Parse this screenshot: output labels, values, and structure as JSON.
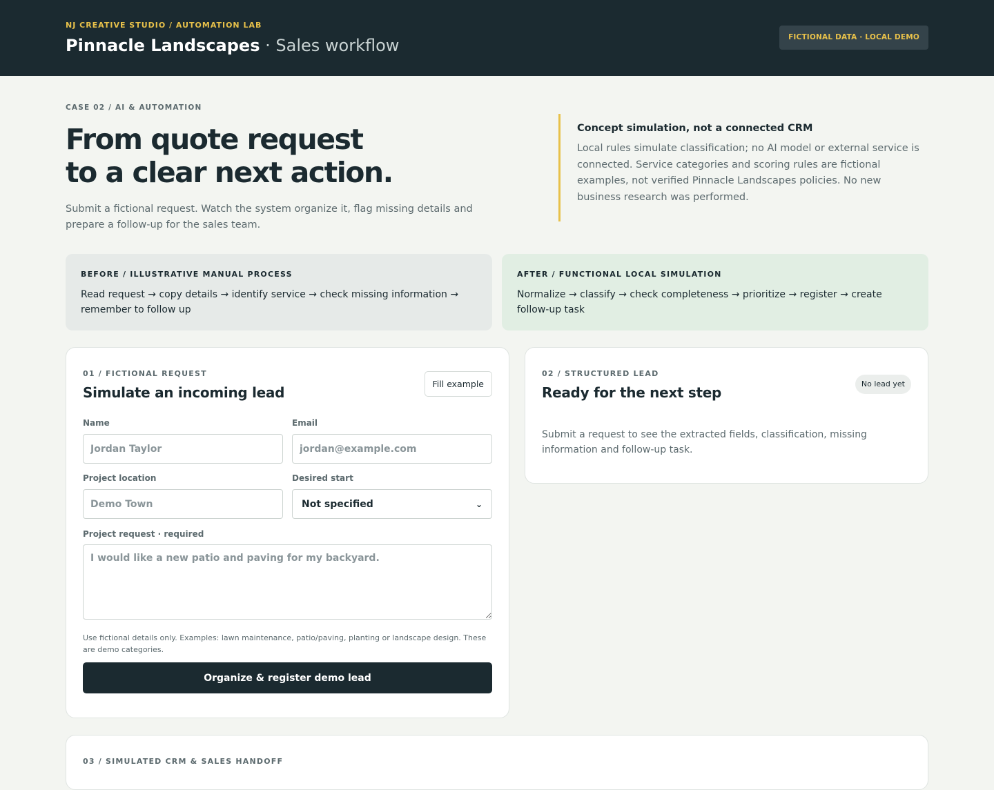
{
  "header": {
    "eyebrow": "NJ CREATIVE STUDIO / AUTOMATION LAB",
    "brand": "Pinnacle Landscapes",
    "separator": " · ",
    "subtitle": "Sales workflow",
    "badge": "FICTIONAL DATA · LOCAL DEMO"
  },
  "hero": {
    "eyebrow": "CASE 02 / AI & AUTOMATION",
    "title_line1": "From quote request",
    "title_line2": "to a clear next action.",
    "subtitle": "Submit a fictional request. Watch the system organize it, flag missing details and prepare a follow-up for the sales team.",
    "note_title": "Concept simulation, not a connected CRM",
    "note_text": "Local rules simulate classification; no AI model or external service is connected. Service categories and scoring rules are fictional examples, not verified Pinnacle Landscapes policies. No new business research was performed."
  },
  "compare": {
    "before_label": "BEFORE / ILLUSTRATIVE MANUAL PROCESS",
    "before_flow": "Read request → copy details → identify service → check missing information → remember to follow up",
    "after_label": "AFTER / FUNCTIONAL LOCAL SIMULATION",
    "after_flow": "Normalize → classify → check completeness → prioritize → register → create follow-up task"
  },
  "form": {
    "eyebrow": "01 / FICTIONAL REQUEST",
    "title": "Simulate an incoming lead",
    "fill_button": "Fill example",
    "name_label": "Name",
    "name_placeholder": "Jordan Taylor",
    "email_label": "Email",
    "email_placeholder": "jordan@example.com",
    "location_label": "Project location",
    "location_placeholder": "Demo Town",
    "start_label": "Desired start",
    "start_value": "Not specified",
    "request_label": "Project request · required",
    "request_placeholder": "I would like a new patio and paving for my backyard.",
    "hint": "Use fictional details only. Examples: lawn maintenance, patio/paving, planting or landscape design. These are demo categories.",
    "submit": "Organize & register demo lead"
  },
  "result": {
    "eyebrow": "02 / STRUCTURED LEAD",
    "title": "Ready for the next step",
    "status": "No lead yet",
    "text": "Submit a request to see the extracted fields, classification, missing information and follow-up task."
  },
  "crm": {
    "eyebrow": "03 / SIMULATED CRM & SALES HANDOFF"
  },
  "colors": {
    "dark": "#1b2a30",
    "accent": "#e8c14a",
    "before_bg": "#e6eae8",
    "after_bg": "#e1eee3"
  }
}
